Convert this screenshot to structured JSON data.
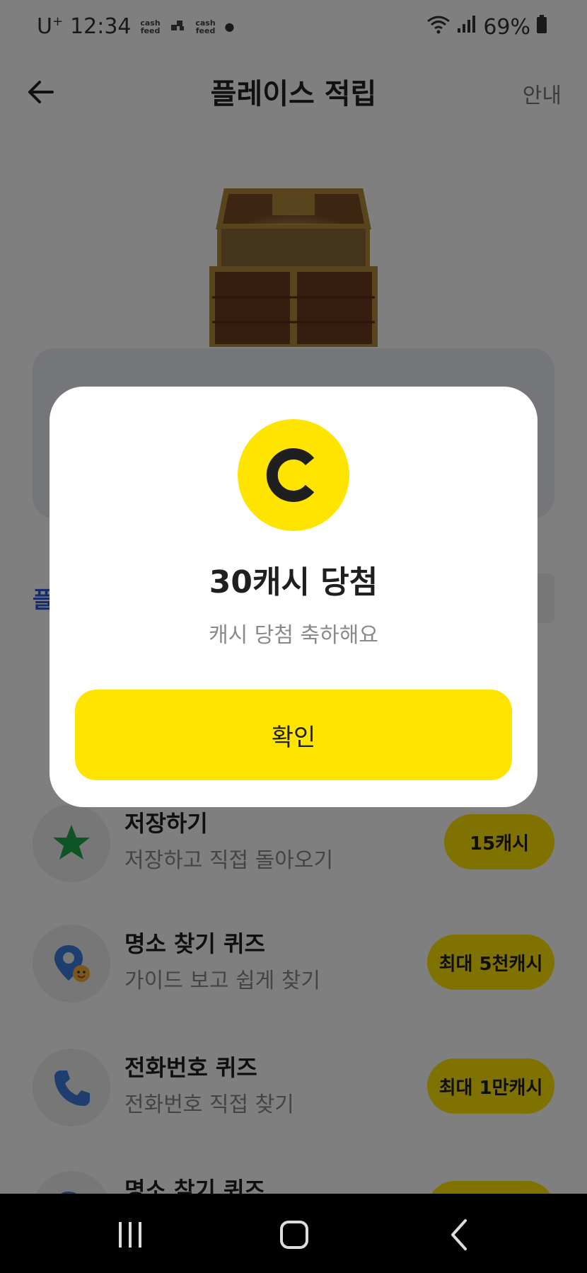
{
  "status_bar": {
    "carrier": "U",
    "carrier_sup": "+",
    "time": "12:34",
    "app_label_1": "cash feed",
    "app_label_2": "cash feed",
    "battery": "69%"
  },
  "header": {
    "title": "플레이스 적립",
    "guide_label": "안내"
  },
  "section": {
    "label": "플"
  },
  "list_items": [
    {
      "title": "저장하기",
      "subtitle": "저장하고 직접 돌아오기",
      "reward": "15캐시",
      "icon": "star-icon"
    },
    {
      "title": "명소 찾기 퀴즈",
      "subtitle": "가이드 보고 쉽게 찾기",
      "reward": "최대 5천캐시",
      "icon": "location-pin-icon"
    },
    {
      "title": "전화번호 퀴즈",
      "subtitle": "전화번호 직접 찾기",
      "reward": "최대 1만캐시",
      "icon": "phone-icon"
    },
    {
      "title": "명소 찾기 퀴즈",
      "subtitle": "",
      "reward": "",
      "icon": "location-pin-icon"
    }
  ],
  "dialog": {
    "coin_letter": "C",
    "title": "30캐시 당첨",
    "message": "캐시 당첨 축하해요",
    "confirm_label": "확인"
  },
  "colors": {
    "accent_yellow": "#ffe400",
    "link_blue": "#2b5bd6",
    "star_green": "#1fa84a",
    "icon_blue": "#3b7ddd"
  }
}
